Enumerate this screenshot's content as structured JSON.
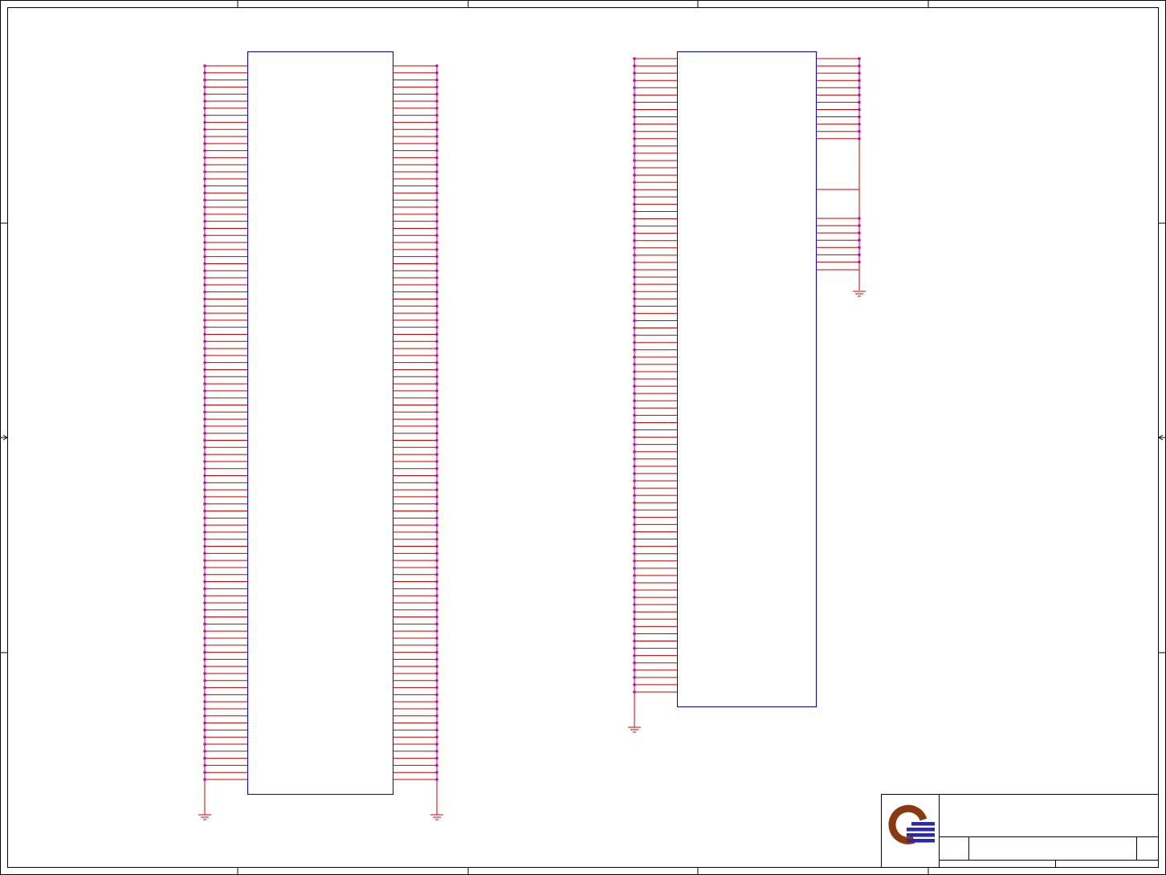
{
  "sheet": {
    "colors": {
      "border": "#000000",
      "component_outline": "#0000cc",
      "wire": "#cc0000",
      "junction": "#cc00cc",
      "ground": "#cc0000",
      "logo_ring": "#8b3a10",
      "logo_bars": "#2a2aa8"
    },
    "border_zone_columns": 5,
    "border_zone_rows": 4
  },
  "components": [
    {
      "id": "connector-left",
      "outline": "rectangle",
      "left_pins": 102,
      "right_pins": 102,
      "left_bus_to_ground": true,
      "right_bus_to_ground": true
    },
    {
      "id": "connector-right",
      "outline": "rectangle",
      "left_pins": 88,
      "right_pins": 19,
      "right_pin_groups": [
        12,
        7
      ],
      "left_bus_to_ground": true,
      "right_bus_to_ground": true
    }
  ],
  "title_block": {
    "logo": "company-logo-icon",
    "title_text": "",
    "sheet_text": ""
  }
}
